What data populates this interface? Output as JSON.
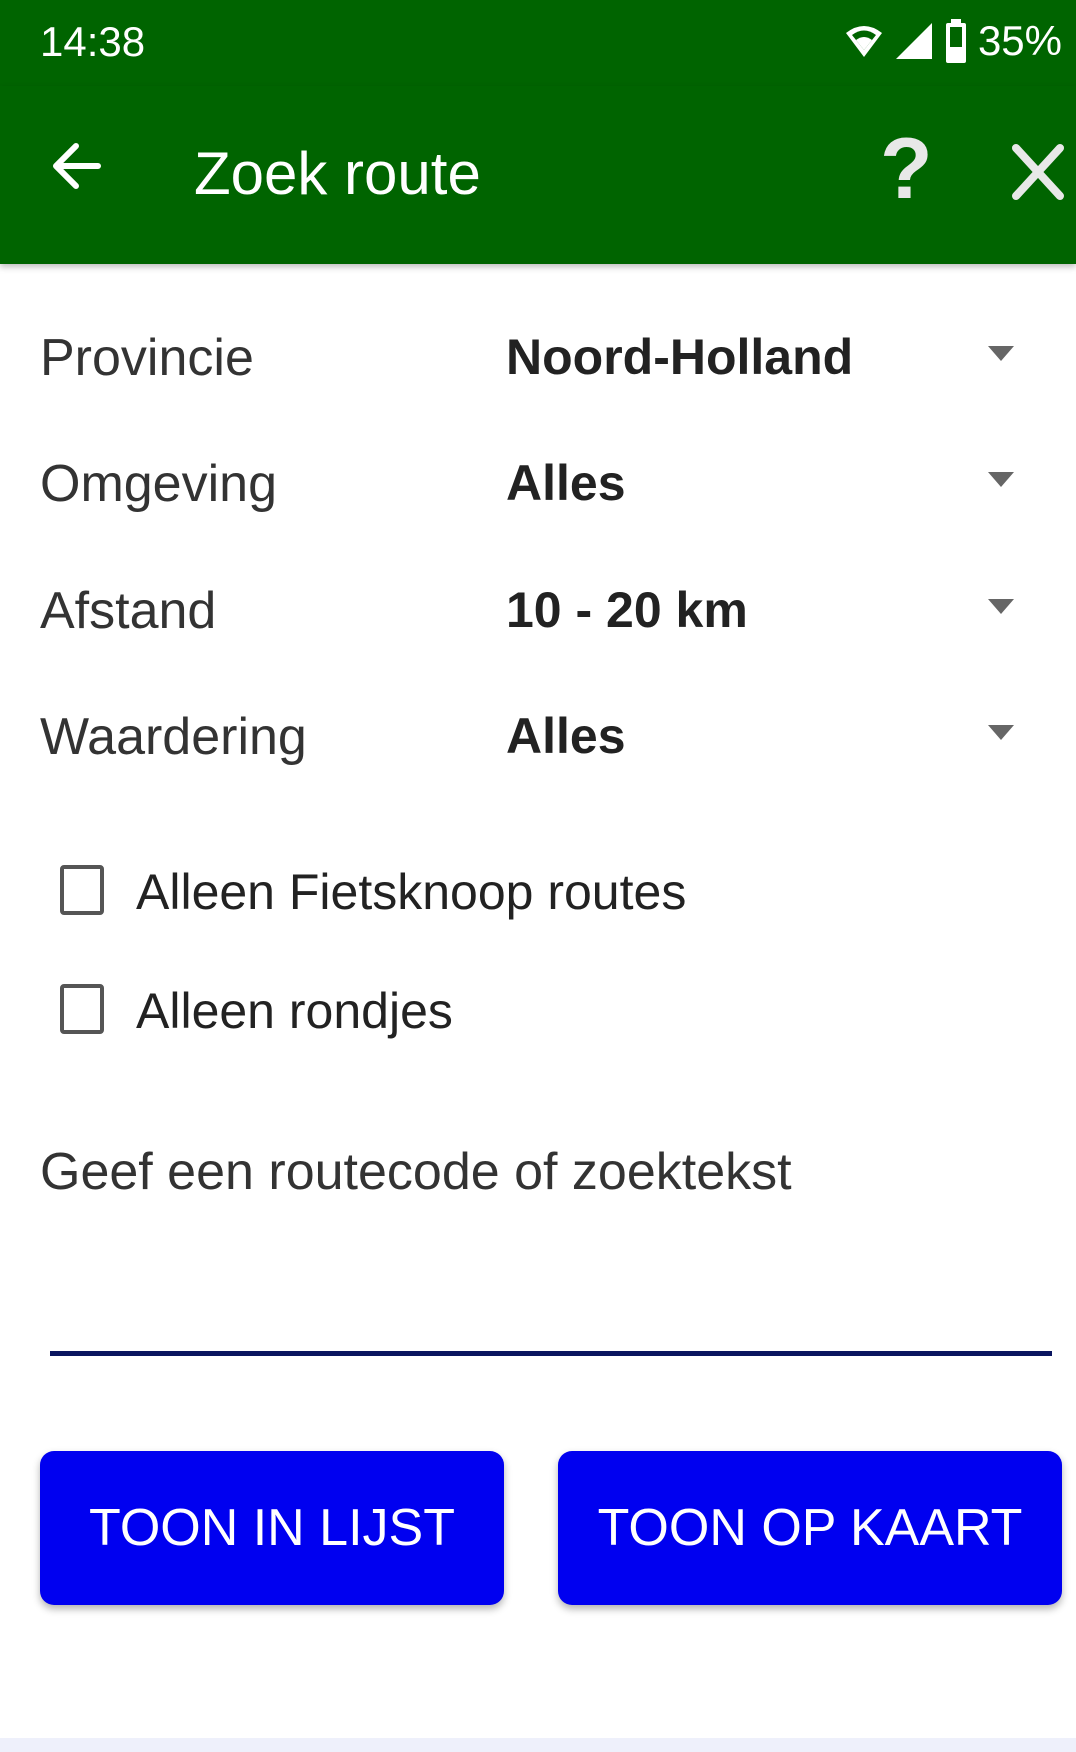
{
  "status": {
    "time": "14:38",
    "battery": "35%",
    "icons": [
      "wifi-icon",
      "signal-icon",
      "battery-icon"
    ]
  },
  "appbar": {
    "title": "Zoek route",
    "help_label": "?",
    "icons": [
      "back-arrow-icon",
      "help-icon",
      "close-icon"
    ],
    "color": "#006400"
  },
  "form": {
    "fields": [
      {
        "label": "Provincie",
        "value": "Noord-Holland"
      },
      {
        "label": "Omgeving",
        "value": "Alles"
      },
      {
        "label": "Afstand",
        "value": "10 - 20 km"
      },
      {
        "label": "Waardering",
        "value": "Alles"
      }
    ],
    "checkboxes": [
      {
        "label": "Alleen Fietsknoop routes",
        "checked": false
      },
      {
        "label": "Alleen rondjes",
        "checked": false
      }
    ],
    "search_label": "Geef een routecode of zoektekst",
    "search_value": ""
  },
  "buttons": {
    "list": "TOON IN LIJST",
    "map": "TOON OP KAART",
    "color": "#0000f0"
  }
}
